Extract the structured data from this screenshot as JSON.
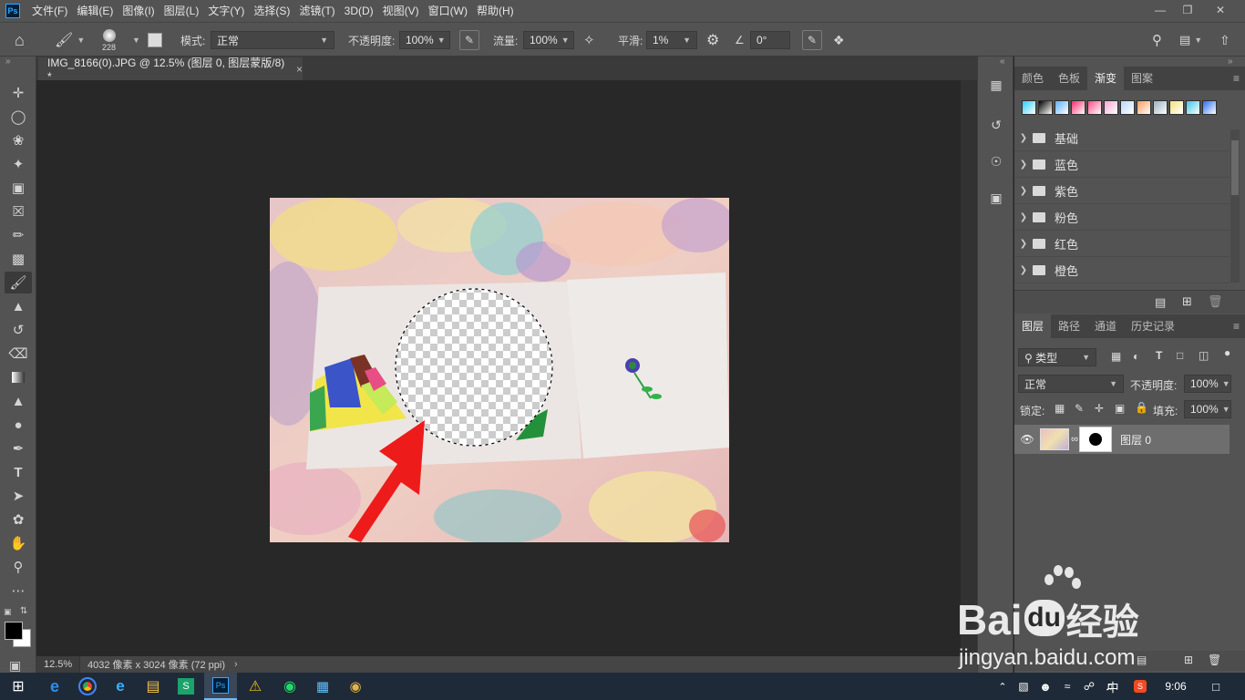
{
  "menubar": {
    "logo": "Ps",
    "items": [
      "文件(F)",
      "编辑(E)",
      "图像(I)",
      "图层(L)",
      "文字(Y)",
      "选择(S)",
      "滤镜(T)",
      "3D(D)",
      "视图(V)",
      "窗口(W)",
      "帮助(H)"
    ]
  },
  "options": {
    "brush_size": "228",
    "mode_label": "模式:",
    "mode_value": "正常",
    "opacity_label": "不透明度:",
    "opacity_value": "100%",
    "flow_label": "流量:",
    "flow_value": "100%",
    "smooth_label": "平滑:",
    "smooth_value": "1%",
    "angle_value": "0°"
  },
  "document": {
    "tab_title": "IMG_8166(0).JPG @ 12.5% (图层 0, 图层蒙版/8) *",
    "close": "×"
  },
  "status": {
    "zoom": "12.5%",
    "info": "4032 像素 x 3024 像素 (72 ppi)"
  },
  "gradient_panel": {
    "tabs": [
      "颜色",
      "色板",
      "渐变",
      "图案"
    ],
    "active_tab": "渐变",
    "swatches": [
      "#2ad0ff",
      "#000000",
      "#5ab0ff",
      "#ff2d6e",
      "#ff4d8a",
      "#f7a6d4",
      "#b7d7ff",
      "#ff9a5a",
      "#9ab0c0",
      "#f4e27a",
      "#3cc7e8",
      "#2a6cf0"
    ],
    "folders": [
      "基础",
      "蓝色",
      "紫色",
      "粉色",
      "红色",
      "橙色"
    ]
  },
  "layers_panel": {
    "tabs": [
      "图层",
      "路径",
      "通道",
      "历史记录"
    ],
    "active_tab": "图层",
    "filter_label": "类型",
    "blend_mode": "正常",
    "opacity_label": "不透明度:",
    "opacity_value": "100%",
    "lock_label": "锁定:",
    "fill_label": "填充:",
    "fill_value": "100%",
    "layer_name": "图层 0"
  },
  "taskbar": {
    "ime": "中",
    "time": "9:06"
  },
  "watermark": {
    "brand": "Bai",
    "brand2": "du",
    "cn": "经验",
    "url": "jingyan.baidu.com"
  }
}
